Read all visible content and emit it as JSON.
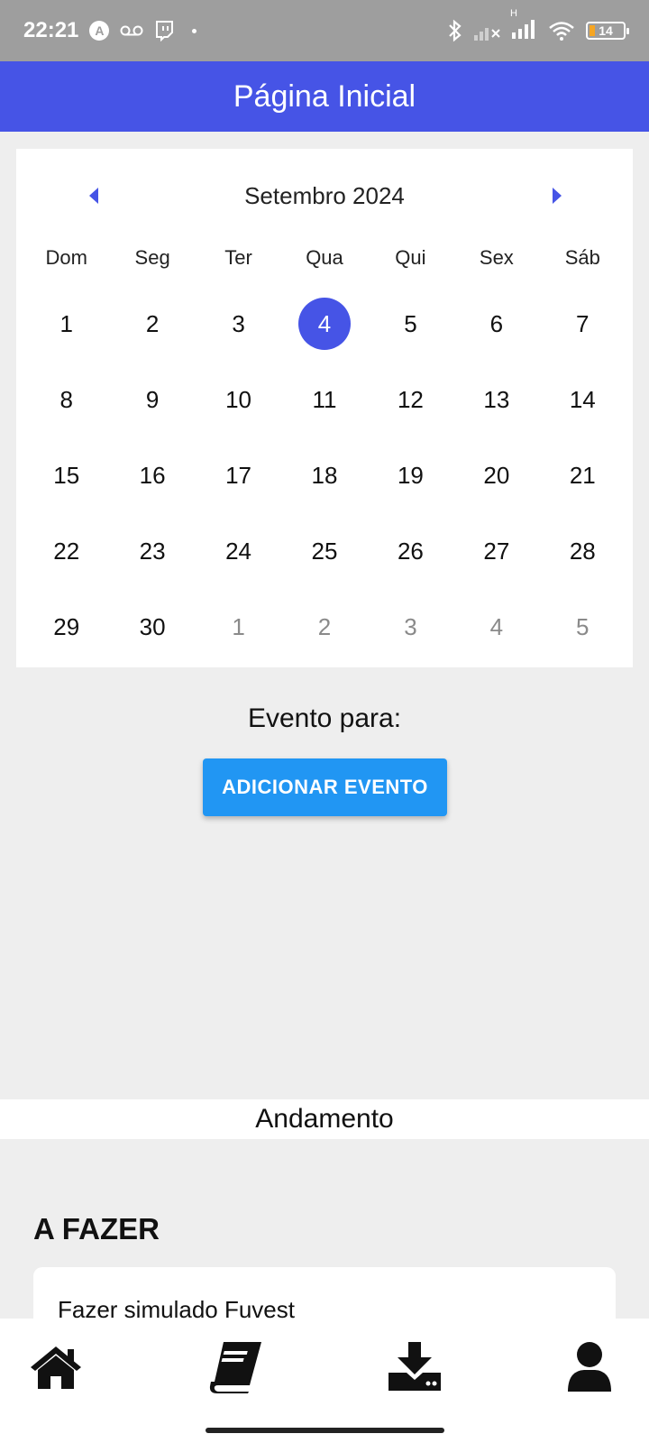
{
  "status_bar": {
    "time": "22:21",
    "network": "H",
    "battery": "14",
    "icons": [
      "app-a-icon",
      "voicemail-icon",
      "twitch-icon",
      "bluetooth-icon",
      "signal-icon",
      "wifi-icon",
      "battery-icon"
    ]
  },
  "app_bar": {
    "title": "Página Inicial"
  },
  "calendar": {
    "month_label": "Setembro 2024",
    "weekdays": [
      "Dom",
      "Seg",
      "Ter",
      "Qua",
      "Qui",
      "Sex",
      "Sáb"
    ],
    "days": [
      {
        "label": "1"
      },
      {
        "label": "2"
      },
      {
        "label": "3"
      },
      {
        "label": "4",
        "selected": true
      },
      {
        "label": "5"
      },
      {
        "label": "6"
      },
      {
        "label": "7"
      },
      {
        "label": "8"
      },
      {
        "label": "9"
      },
      {
        "label": "10"
      },
      {
        "label": "11"
      },
      {
        "label": "12"
      },
      {
        "label": "13"
      },
      {
        "label": "14"
      },
      {
        "label": "15"
      },
      {
        "label": "16"
      },
      {
        "label": "17"
      },
      {
        "label": "18"
      },
      {
        "label": "19"
      },
      {
        "label": "20"
      },
      {
        "label": "21"
      },
      {
        "label": "22"
      },
      {
        "label": "23"
      },
      {
        "label": "24"
      },
      {
        "label": "25"
      },
      {
        "label": "26"
      },
      {
        "label": "27"
      },
      {
        "label": "28"
      },
      {
        "label": "29"
      },
      {
        "label": "30"
      },
      {
        "label": "1",
        "other_month": true
      },
      {
        "label": "2",
        "other_month": true
      },
      {
        "label": "3",
        "other_month": true
      },
      {
        "label": "4",
        "other_month": true
      },
      {
        "label": "5",
        "other_month": true
      }
    ],
    "accent_color": "#4654e6"
  },
  "event": {
    "label": "Evento para:",
    "add_button": "ADICIONAR EVENTO",
    "button_color": "#2196f3"
  },
  "progress": {
    "header": "Andamento",
    "todo_title": "A FAZER",
    "tasks": [
      "Fazer simulado Fuvest"
    ]
  },
  "bottom_nav": {
    "items": [
      "home-icon",
      "book-icon",
      "download-icon",
      "user-icon"
    ]
  }
}
